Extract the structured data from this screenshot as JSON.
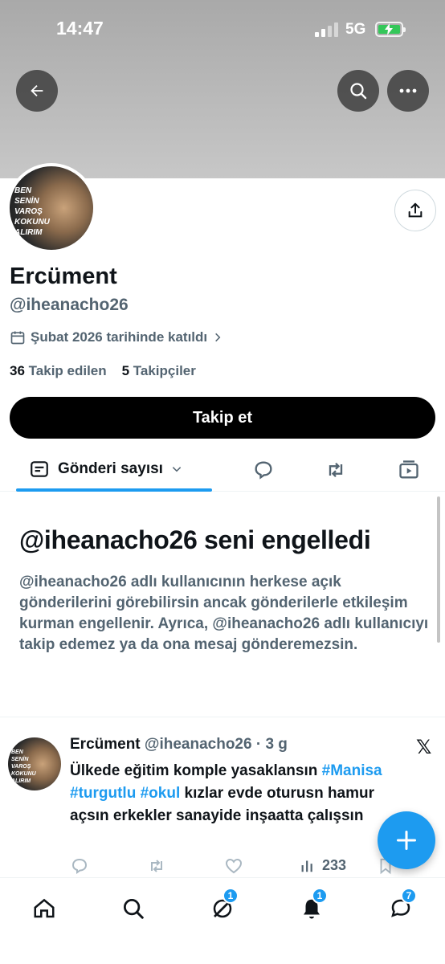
{
  "status_bar": {
    "time": "14:47",
    "network": "5G"
  },
  "profile": {
    "avatar_text": "BEN SENİN VAROŞ KOKUNU ALIRIM",
    "name": "Ercüment",
    "handle": "@iheanacho26",
    "joined": "Şubat 2026 tarihinde katıldı",
    "following_count": "36",
    "following_label": "Takip edilen",
    "followers_count": "5",
    "followers_label": "Takipçiler",
    "follow_button": "Takip et"
  },
  "tabs": {
    "posts_label": "Gönderi sayısı"
  },
  "blocked": {
    "title": "@iheanacho26 seni engelledi",
    "text": "@iheanacho26 adlı kullanıcının herkese açık gönderilerini görebilirsin ancak gönderilerle etkileşim kurman engellenir. Ayrıca, @iheanacho26 adlı kullanıcıyı takip edemez ya da ona mesaj gönderemezsin."
  },
  "tweet": {
    "avatar_text": "BEN SENİN VAROŞ KOKUNU ALIRIM",
    "name": "Ercüment",
    "handle_time": "@iheanacho26 · 3 g",
    "text_1": "Ülkede eğitim komple yasaklansın ",
    "tag_1": "#Manisa",
    "tag_2": "#turgutlu",
    "tag_3": "#okul",
    "text_2": " kızlar evde oturusn hamur açsın erkekler sanayide inşaatta çalışsın",
    "views": "233"
  },
  "bottom_nav": {
    "grok_badge": "1",
    "notifications_badge": "1",
    "messages_badge": "7"
  },
  "colors": {
    "accent": "#1d9bf0",
    "text": "#0f1419",
    "muted": "#536471"
  }
}
